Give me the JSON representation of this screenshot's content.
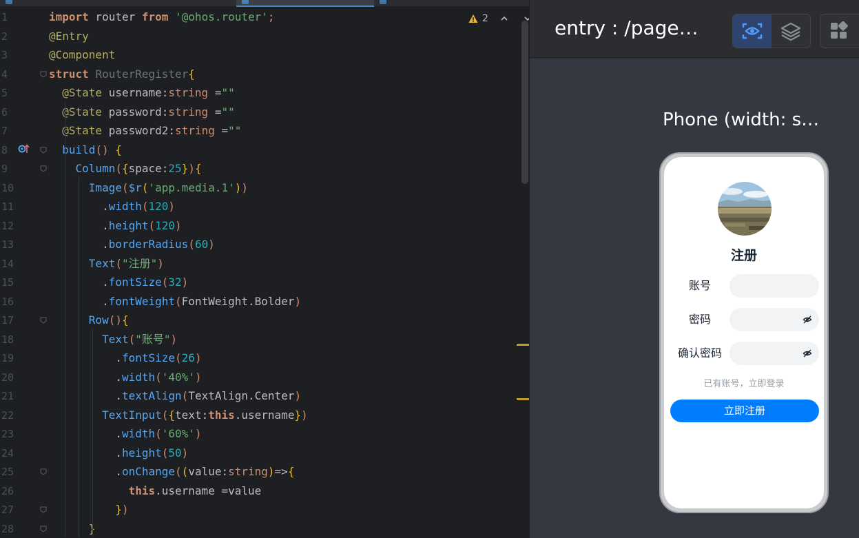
{
  "editor": {
    "lines": [
      {
        "n": "1",
        "parts": [
          [
            "kw",
            "import"
          ],
          [
            "cls",
            " router "
          ],
          [
            "kw",
            "from"
          ],
          [
            "cls",
            " "
          ],
          [
            "str",
            "'@ohos.router'"
          ],
          [
            "p2",
            ";"
          ]
        ]
      },
      {
        "n": "2",
        "parts": [
          [
            "ann",
            "@Entry"
          ]
        ]
      },
      {
        "n": "3",
        "parts": [
          [
            "ann",
            "@Component"
          ]
        ]
      },
      {
        "n": "4",
        "parts": [
          [
            "kw",
            "struct"
          ],
          [
            "cls",
            " "
          ],
          [
            "gray",
            "RouterRegister"
          ],
          [
            "p1",
            "{"
          ]
        ]
      },
      {
        "n": "5",
        "parts": [
          [
            "cls",
            "  "
          ],
          [
            "ann",
            "@State"
          ],
          [
            "cls",
            " username:"
          ],
          [
            "typ",
            "string"
          ],
          [
            "cls",
            " ="
          ],
          [
            "str",
            "\"\""
          ]
        ]
      },
      {
        "n": "6",
        "parts": [
          [
            "cls",
            "  "
          ],
          [
            "ann",
            "@State"
          ],
          [
            "cls",
            " password:"
          ],
          [
            "typ",
            "string"
          ],
          [
            "cls",
            " ="
          ],
          [
            "str",
            "\"\""
          ]
        ]
      },
      {
        "n": "7",
        "parts": [
          [
            "cls",
            "  "
          ],
          [
            "ann",
            "@State"
          ],
          [
            "cls",
            " password2:"
          ],
          [
            "typ",
            "string"
          ],
          [
            "cls",
            " ="
          ],
          [
            "str",
            "\"\""
          ]
        ]
      },
      {
        "n": "8",
        "parts": [
          [
            "cls",
            "  "
          ],
          [
            "fn",
            "build"
          ],
          [
            "p2",
            "()"
          ],
          [
            "cls",
            " "
          ],
          [
            "p1",
            "{"
          ]
        ]
      },
      {
        "n": "9",
        "parts": [
          [
            "cls",
            "    "
          ],
          [
            "fn",
            "Column"
          ],
          [
            "p2",
            "("
          ],
          [
            "p1",
            "{"
          ],
          [
            "cls",
            "space:"
          ],
          [
            "num",
            "25"
          ],
          [
            "p1",
            "}"
          ],
          [
            "p2",
            ")"
          ],
          [
            "p1",
            "{"
          ]
        ]
      },
      {
        "n": "10",
        "parts": [
          [
            "cls",
            "      "
          ],
          [
            "fn",
            "Image"
          ],
          [
            "p2",
            "("
          ],
          [
            "fn",
            "$r"
          ],
          [
            "p1",
            "("
          ],
          [
            "str",
            "'app.media.1'"
          ],
          [
            "p1",
            ")"
          ],
          [
            "p2",
            ")"
          ]
        ]
      },
      {
        "n": "11",
        "parts": [
          [
            "cls",
            "        ."
          ],
          [
            "fn",
            "width"
          ],
          [
            "p2",
            "("
          ],
          [
            "num",
            "120"
          ],
          [
            "p2",
            ")"
          ]
        ]
      },
      {
        "n": "12",
        "parts": [
          [
            "cls",
            "        ."
          ],
          [
            "fn",
            "height"
          ],
          [
            "p2",
            "("
          ],
          [
            "num",
            "120"
          ],
          [
            "p2",
            ")"
          ]
        ]
      },
      {
        "n": "13",
        "parts": [
          [
            "cls",
            "        ."
          ],
          [
            "fn",
            "borderRadius"
          ],
          [
            "p2",
            "("
          ],
          [
            "num",
            "60"
          ],
          [
            "p2",
            ")"
          ]
        ]
      },
      {
        "n": "14",
        "parts": [
          [
            "cls",
            "      "
          ],
          [
            "fn",
            "Text"
          ],
          [
            "p2",
            "("
          ],
          [
            "str",
            "\"注册\""
          ],
          [
            "p2",
            ")"
          ]
        ]
      },
      {
        "n": "15",
        "parts": [
          [
            "cls",
            "        ."
          ],
          [
            "fn",
            "fontSize"
          ],
          [
            "p2",
            "("
          ],
          [
            "num",
            "32"
          ],
          [
            "p2",
            ")"
          ]
        ]
      },
      {
        "n": "16",
        "parts": [
          [
            "cls",
            "        ."
          ],
          [
            "fn",
            "fontWeight"
          ],
          [
            "p2",
            "("
          ],
          [
            "cls",
            "FontWeight.Bolder"
          ],
          [
            "p2",
            ")"
          ]
        ]
      },
      {
        "n": "17",
        "parts": [
          [
            "cls",
            "      "
          ],
          [
            "fn",
            "Row"
          ],
          [
            "p2",
            "()"
          ],
          [
            "p1",
            "{"
          ]
        ]
      },
      {
        "n": "18",
        "parts": [
          [
            "cls",
            "        "
          ],
          [
            "fn",
            "Text"
          ],
          [
            "p2",
            "("
          ],
          [
            "str",
            "\"账号\""
          ],
          [
            "p2",
            ")"
          ]
        ]
      },
      {
        "n": "19",
        "parts": [
          [
            "cls",
            "          ."
          ],
          [
            "fn",
            "fontSize"
          ],
          [
            "p2",
            "("
          ],
          [
            "num",
            "26"
          ],
          [
            "p2",
            ")"
          ]
        ]
      },
      {
        "n": "20",
        "parts": [
          [
            "cls",
            "          ."
          ],
          [
            "fn",
            "width"
          ],
          [
            "p2",
            "("
          ],
          [
            "str",
            "'40%'"
          ],
          [
            "p2",
            ")"
          ]
        ]
      },
      {
        "n": "21",
        "parts": [
          [
            "cls",
            "          ."
          ],
          [
            "fn",
            "textAlign"
          ],
          [
            "p2",
            "("
          ],
          [
            "cls",
            "TextAlign.Center"
          ],
          [
            "p2",
            ")"
          ]
        ]
      },
      {
        "n": "22",
        "parts": [
          [
            "cls",
            "        "
          ],
          [
            "fn",
            "TextInput"
          ],
          [
            "p2",
            "("
          ],
          [
            "p1",
            "{"
          ],
          [
            "cls",
            "text:"
          ],
          [
            "kw",
            "this"
          ],
          [
            "cls",
            ".username"
          ],
          [
            "p1",
            "}"
          ],
          [
            "p2",
            ")"
          ]
        ]
      },
      {
        "n": "23",
        "parts": [
          [
            "cls",
            "          ."
          ],
          [
            "fn",
            "width"
          ],
          [
            "p2",
            "("
          ],
          [
            "str",
            "'60%'"
          ],
          [
            "p2",
            ")"
          ]
        ]
      },
      {
        "n": "24",
        "parts": [
          [
            "cls",
            "          ."
          ],
          [
            "fn",
            "height"
          ],
          [
            "p2",
            "("
          ],
          [
            "num",
            "50"
          ],
          [
            "p2",
            ")"
          ]
        ]
      },
      {
        "n": "25",
        "parts": [
          [
            "cls",
            "          ."
          ],
          [
            "fn",
            "onChange"
          ],
          [
            "p2",
            "("
          ],
          [
            "p1",
            "("
          ],
          [
            "cls",
            "value:"
          ],
          [
            "typ",
            "string"
          ],
          [
            "p1",
            ")"
          ],
          [
            "cls",
            "=>"
          ],
          [
            "p1",
            "{"
          ]
        ]
      },
      {
        "n": "26",
        "parts": [
          [
            "cls",
            "            "
          ],
          [
            "kw",
            "this"
          ],
          [
            "cls",
            ".username =value"
          ]
        ]
      },
      {
        "n": "27",
        "parts": [
          [
            "cls",
            "          "
          ],
          [
            "p1",
            "}"
          ],
          [
            "p2",
            ")"
          ]
        ]
      },
      {
        "n": "28",
        "parts": [
          [
            "cls",
            "      "
          ],
          [
            "p1",
            "}"
          ]
        ]
      }
    ],
    "inspection_count": "2"
  },
  "preview": {
    "title": "entry : /page…",
    "device_label": "Phone (width: s…",
    "app": {
      "title": "注册",
      "rows": [
        {
          "label": "账号",
          "has_eye": false
        },
        {
          "label": "密码",
          "has_eye": true
        },
        {
          "label": "确认密码",
          "has_eye": true
        }
      ],
      "login_link": "已有账号，立即登录",
      "register_button": "立即注册"
    }
  },
  "colors": {
    "accent": "#007dff",
    "editor_bg": "#1e1f22",
    "preview_bg": "#343840",
    "toolbar_active": "#2e436e"
  }
}
